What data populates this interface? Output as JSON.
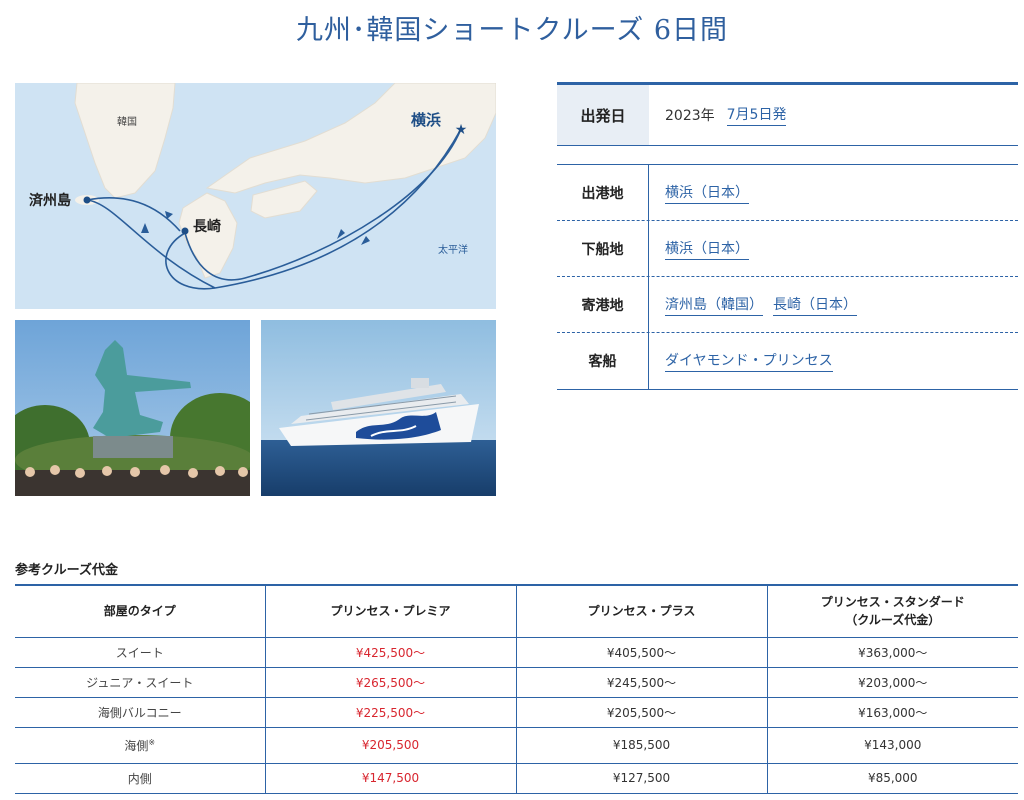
{
  "title": "九州･韓国ショートクルーズ 6日間",
  "map": {
    "labels": {
      "korea": "韓国",
      "yokohama": "横浜",
      "jeju": "済州島",
      "nagasaki": "長崎",
      "pacific": "太平洋"
    }
  },
  "info": {
    "departure_label": "出発日",
    "departure_year": "2023年",
    "departure_date": "7月5日発",
    "rows": [
      {
        "label": "出港地",
        "links": [
          "横浜（日本）"
        ]
      },
      {
        "label": "下船地",
        "links": [
          "横浜（日本）"
        ]
      },
      {
        "label": "寄港地",
        "links": [
          "済州島（韓国）",
          "長崎（日本）"
        ]
      },
      {
        "label": "客船",
        "links": [
          "ダイヤモンド・プリンセス"
        ]
      }
    ]
  },
  "prices": {
    "title": "参考クルーズ代金",
    "headers": [
      "部屋のタイプ",
      "プリンセス・プレミア",
      "プリンセス・プラス",
      "プリンセス・スタンダード",
      "（クルーズ代金）"
    ],
    "rows": [
      {
        "type": "スイート",
        "note": "",
        "premier": "¥425,500～",
        "plus": "¥405,500～",
        "standard": "¥363,000～"
      },
      {
        "type": "ジュニア・スイート",
        "note": "",
        "premier": "¥265,500～",
        "plus": "¥245,500～",
        "standard": "¥203,000～"
      },
      {
        "type": "海側バルコニー",
        "note": "",
        "premier": "¥225,500～",
        "plus": "¥205,500～",
        "standard": "¥163,000～"
      },
      {
        "type": "海側",
        "note": "※",
        "premier": "¥205,500",
        "plus": "¥185,500",
        "standard": "¥143,000"
      },
      {
        "type": "内側",
        "note": "",
        "premier": "¥147,500",
        "plus": "¥127,500",
        "standard": "¥85,000"
      }
    ]
  },
  "colors": {
    "accent": "#2d63a6",
    "price_red": "#d8262f",
    "map_sea": "#cfe3f3",
    "map_land": "#f4f1ea"
  }
}
